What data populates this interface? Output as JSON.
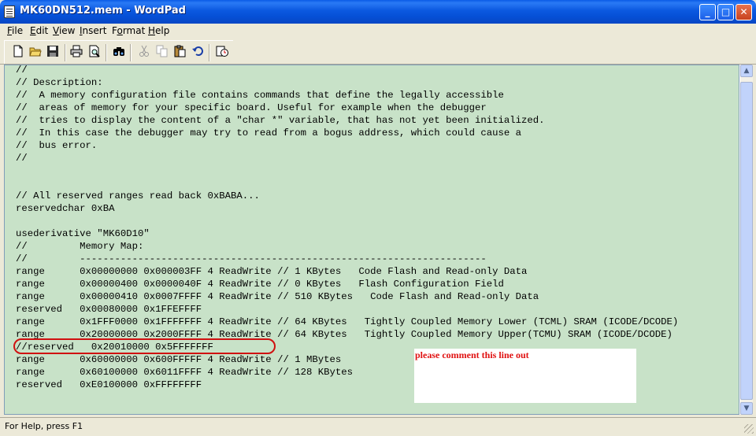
{
  "window": {
    "title": "MK60DN512.mem - WordPad",
    "minimize": "_",
    "maximize": "□",
    "close": "✕"
  },
  "menu": [
    {
      "label": "File",
      "mnemonic": "F"
    },
    {
      "label": "Edit",
      "mnemonic": "E"
    },
    {
      "label": "View",
      "mnemonic": "V"
    },
    {
      "label": "Insert",
      "mnemonic": "I"
    },
    {
      "label": "Format",
      "mnemonic": "o"
    },
    {
      "label": "Help",
      "mnemonic": "H"
    }
  ],
  "toolbar": {
    "icons": [
      "new-document-icon",
      "open-folder-icon",
      "save-disk-icon",
      "print-icon",
      "print-preview-icon",
      "find-binoculars-icon",
      "cut-scissors-icon",
      "copy-icon",
      "paste-icon",
      "undo-icon",
      "insert-datetime-icon"
    ]
  },
  "document": {
    "text": "//\n// Description:\n//  A memory configuration file contains commands that define the legally accessible\n//  areas of memory for your specific board. Useful for example when the debugger\n//  tries to display the content of a \"char *\" variable, that has not yet been initialized.\n//  In this case the debugger may try to read from a bogus address, which could cause a\n//  bus error.\n//\n\n\n// All reserved ranges read back 0xBABA...\nreservedchar 0xBA\n\nusederivative \"MK60D10\"\n//         Memory Map:\n//         ----------------------------------------------------------------------\nrange      0x00000000 0x000003FF 4 ReadWrite // 1 KBytes   Code Flash and Read-only Data\nrange      0x00000400 0x0000040F 4 ReadWrite // 0 KBytes   Flash Configuration Field\nrange      0x00000410 0x0007FFFF 4 ReadWrite // 510 KBytes   Code Flash and Read-only Data\nreserved   0x00080000 0x1FFEFFFF\nrange      0x1FFF0000 0x1FFFFFFF 4 ReadWrite // 64 KBytes   Tightly Coupled Memory Lower (TCML) SRAM (ICODE/DCODE)\nrange      0x20000000 0x2000FFFF 4 ReadWrite // 64 KBytes   Tightly Coupled Memory Upper(TCMU) SRAM (ICODE/DCODE)\n//reserved   0x20010000 0x5FFFFFFF\nrange      0x60000000 0x600FFFFF 4 ReadWrite // 1 MBytes\nrange      0x60100000 0x6011FFFF 4 ReadWrite // 128 KBytes\nreserved   0xE0100000 0xFFFFFFFF",
    "annotation": "please comment this line out",
    "background_color": "#c8e2c8",
    "highlight_color": "#d01010"
  },
  "scrollbar": {
    "up": "▲",
    "down": "▼"
  },
  "status": {
    "text": "For Help, press F1"
  }
}
